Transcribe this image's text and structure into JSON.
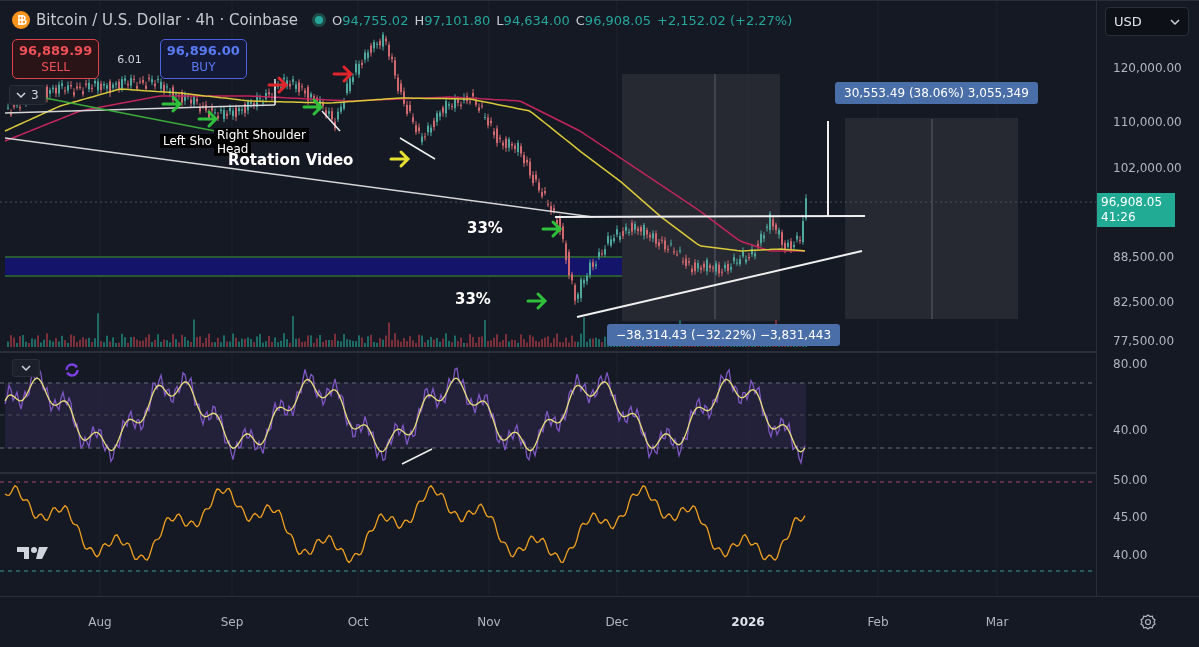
{
  "header": {
    "symbol": "Bitcoin / U.S. Dollar · 4h · Coinbase",
    "ohlc": [
      {
        "label": "O",
        "value": "94,755.02"
      },
      {
        "label": "H",
        "value": "97,101.80"
      },
      {
        "label": "L",
        "value": "94,634.00"
      },
      {
        "label": "C",
        "value": "96,908.05"
      }
    ],
    "change": "+2,152.02 (+2.27%)"
  },
  "trade": {
    "sell_price": "96,889.99",
    "sell_label": "SELL",
    "spread": "6.01",
    "buy_price": "96,896.00",
    "buy_label": "BUY"
  },
  "indicators_toggle": {
    "count": "3"
  },
  "currency": "USD",
  "price_axis": [
    "120,000.00",
    "110,000.00",
    "102,000.00",
    "88,500.00",
    "82,500.00",
    "77,500.00"
  ],
  "last_price": {
    "price": "96,908.05",
    "countdown": "41:26"
  },
  "annotations": [
    {
      "kind": "label",
      "text": "Left Sho"
    },
    {
      "kind": "label",
      "text": "Right Shoulder"
    },
    {
      "kind": "label",
      "text": "Head"
    },
    {
      "kind": "title",
      "text": "Rotation Video"
    },
    {
      "kind": "title",
      "text": "33%"
    },
    {
      "kind": "title",
      "text": "33%"
    }
  ],
  "measures": [
    "30,553.49 (38.06%) 3,055,349",
    "−38,314.43 (−32.22%) −3,831,443"
  ],
  "rsi_axis": [
    "80.00",
    "40.00"
  ],
  "osc_axis": [
    "50.00",
    "45.00",
    "40.00"
  ],
  "time_axis": [
    {
      "label": "Aug",
      "kind": "month"
    },
    {
      "label": "Sep",
      "kind": "month"
    },
    {
      "label": "Oct",
      "kind": "month"
    },
    {
      "label": "Nov",
      "kind": "month"
    },
    {
      "label": "Dec",
      "kind": "month"
    },
    {
      "label": "2026",
      "kind": "year"
    },
    {
      "label": "Feb",
      "kind": "month"
    },
    {
      "label": "Mar",
      "kind": "month"
    }
  ]
}
